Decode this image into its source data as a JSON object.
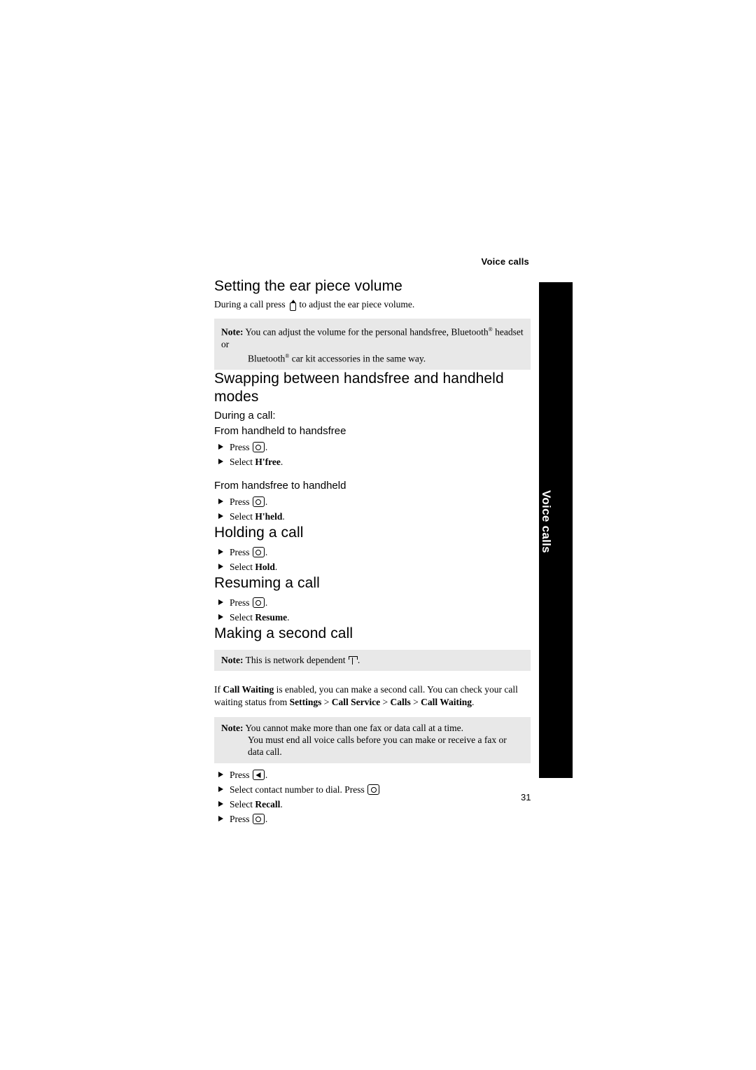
{
  "page": {
    "running_header": "Voice calls",
    "page_number": "31",
    "side_tab_label": "Voice calls"
  },
  "sections": [
    {
      "id": "ear-piece-volume",
      "heading": "Setting the ear piece volume",
      "body": "During a call press",
      "body_tail": "to adjust the ear piece volume.",
      "note": {
        "label": "Note:",
        "line1": "You can adjust the volume for the personal handsfree, Bluetooth",
        "line1_sup": "®",
        "line1_tail": "headset or",
        "line2": "Bluetooth",
        "line2_sup": "®",
        "line2_tail": "car kit accessories in the same way."
      }
    },
    {
      "id": "swapping-modes",
      "heading": "Swapping between handsfree and handheld modes",
      "intro": "During a call:",
      "sub1": "From handheld to handsfree",
      "steps1": [
        {
          "prefix": "Press",
          "icon": "select-key-icon",
          "suffix": "."
        },
        {
          "prefix": "Select",
          "bold": "H'free",
          "suffix": "."
        }
      ],
      "sub2": "From handsfree to handheld",
      "steps2": [
        {
          "prefix": "Press",
          "icon": "select-key-icon",
          "suffix": "."
        },
        {
          "prefix": "Select",
          "bold": "H'held",
          "suffix": "."
        }
      ]
    },
    {
      "id": "holding-a-call",
      "heading": "Holding a call",
      "steps": [
        {
          "prefix": "Press",
          "icon": "select-key-icon",
          "suffix": "."
        },
        {
          "prefix": "Select",
          "bold": "Hold",
          "suffix": "."
        }
      ]
    },
    {
      "id": "resuming-a-call",
      "heading": "Resuming a call",
      "steps": [
        {
          "prefix": "Press",
          "icon": "select-key-icon",
          "suffix": "."
        },
        {
          "prefix": "Select",
          "bold": "Resume",
          "suffix": "."
        }
      ]
    },
    {
      "id": "making-second-call",
      "heading": "Making a second call",
      "note_network": {
        "label": "Note:",
        "text": "This is network dependent",
        "icon": "network-dependent-icon",
        "tail": "."
      },
      "para": {
        "t1": "If ",
        "b1": "Call Waiting",
        "t2": " is enabled, you can make a second call. You can check your call waiting status from ",
        "b2": "Settings",
        "t3": " > ",
        "b3": "Call Service",
        "t4": " > ",
        "b4": "Calls",
        "t5": " > ",
        "b5": "Call Waiting",
        "t6": "."
      },
      "note2": {
        "label": "Note:",
        "line1": "You cannot make more than one fax or data call at a time.",
        "line2": "You must end all voice calls before you can make or receive a fax or data call."
      },
      "steps": [
        {
          "prefix": "Press",
          "icon": "back-key-icon",
          "suffix": "."
        },
        {
          "prefix": "Select contact number to dial. Press",
          "icon": "select-key-icon",
          "suffix": ""
        },
        {
          "prefix": "Select",
          "bold": "Recall",
          "suffix": "."
        },
        {
          "prefix": "Press",
          "icon": "select-key-icon",
          "suffix": "."
        }
      ]
    }
  ]
}
